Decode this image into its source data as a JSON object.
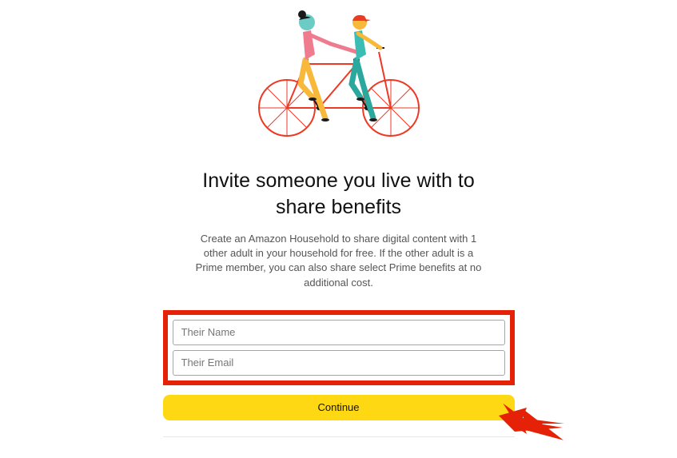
{
  "page": {
    "heading": "Invite someone you live with to share benefits",
    "description": "Create an Amazon Household to share digital content with 1 other adult in your household for free. If the other adult is a Prime member, you can also share select Prime benefits at no additional cost."
  },
  "form": {
    "name_placeholder": "Their Name",
    "name_value": "",
    "email_placeholder": "Their Email",
    "email_value": "",
    "continue_label": "Continue"
  },
  "annotations": {
    "highlight_color": "#e52207",
    "arrow_color": "#e52207"
  }
}
